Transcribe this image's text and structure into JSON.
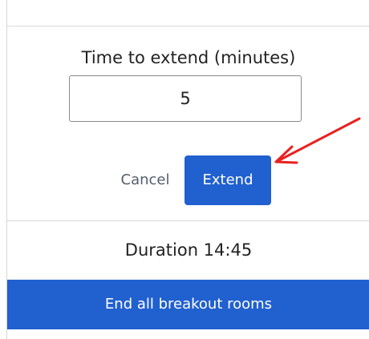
{
  "extend": {
    "label": "Time to extend (minutes)",
    "value": "5"
  },
  "actions": {
    "cancel_label": "Cancel",
    "extend_label": "Extend"
  },
  "duration_text": "Duration 14:45",
  "end_all_label": "End all breakout rooms",
  "colors": {
    "primary": "#2160cf",
    "annotation_arrow": "#e8211f"
  },
  "icons": {
    "annotation": "red-arrow-annotation-icon"
  }
}
